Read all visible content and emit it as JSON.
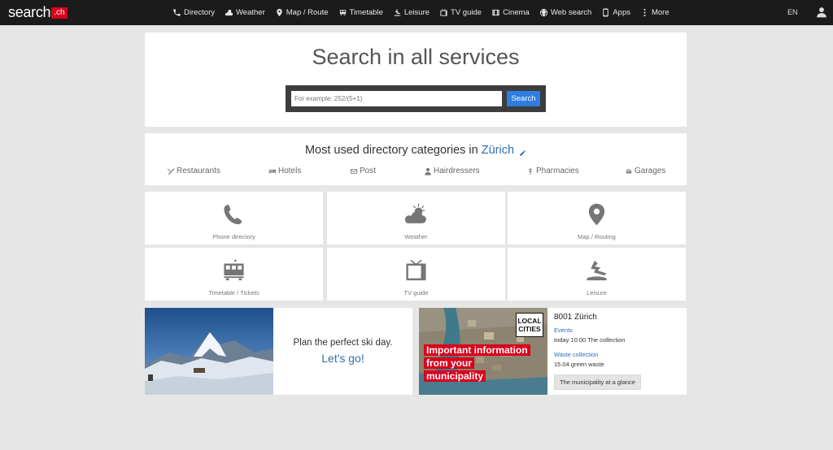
{
  "logo": {
    "word": "search",
    "tld": ".ch"
  },
  "nav": {
    "items": [
      {
        "label": "Directory",
        "icon": "phone-icon"
      },
      {
        "label": "Weather",
        "icon": "cloud-sun-icon"
      },
      {
        "label": "Map / Route",
        "icon": "map-pin-icon"
      },
      {
        "label": "Timetable",
        "icon": "train-icon"
      },
      {
        "label": "Leisure",
        "icon": "leisure-icon"
      },
      {
        "label": "TV guide",
        "icon": "tv-icon"
      },
      {
        "label": "Cinema",
        "icon": "film-icon"
      },
      {
        "label": "Web search",
        "icon": "globe-icon"
      },
      {
        "label": "Apps",
        "icon": "phone-device-icon"
      },
      {
        "label": "More",
        "icon": "more-icon"
      }
    ],
    "language": "EN"
  },
  "hero": {
    "title": "Search in all services",
    "placeholder": "For example: 252/(5+1)",
    "search_label": "Search"
  },
  "categories": {
    "title_prefix": "Most used directory categories in",
    "city": "Zürich",
    "items": [
      {
        "label": "Restaurants",
        "icon": "cutlery-icon"
      },
      {
        "label": "Hotels",
        "icon": "bed-icon"
      },
      {
        "label": "Post",
        "icon": "envelope-icon"
      },
      {
        "label": "Hairdressers",
        "icon": "person-icon"
      },
      {
        "label": "Pharmacies",
        "icon": "pharmacy-icon"
      },
      {
        "label": "Garages",
        "icon": "car-icon"
      }
    ]
  },
  "tiles": [
    {
      "label": "Phone directory",
      "icon": "phone-icon"
    },
    {
      "label": "Weather",
      "icon": "cloud-sun-icon"
    },
    {
      "label": "Map / Routing",
      "icon": "map-pin-icon"
    },
    {
      "label": "Timetable / Tickets",
      "icon": "train-icon"
    },
    {
      "label": "TV guide",
      "icon": "tv-icon"
    },
    {
      "label": "Leisure",
      "icon": "leisure-icon"
    }
  ],
  "ski": {
    "line1": "Plan the perfect ski day.",
    "line2": "Let's go!"
  },
  "local": {
    "badge_line1": "LOCAL",
    "badge_line2": "CITIES",
    "important_lines": [
      "Important information",
      "from your",
      "municipality"
    ],
    "title": "8001 Zürich",
    "link1": "Events",
    "text1": "today 10:00 The collection",
    "link2": "Waste collection",
    "text2": "15.04 green waste",
    "button": "The municipality at a glance"
  }
}
